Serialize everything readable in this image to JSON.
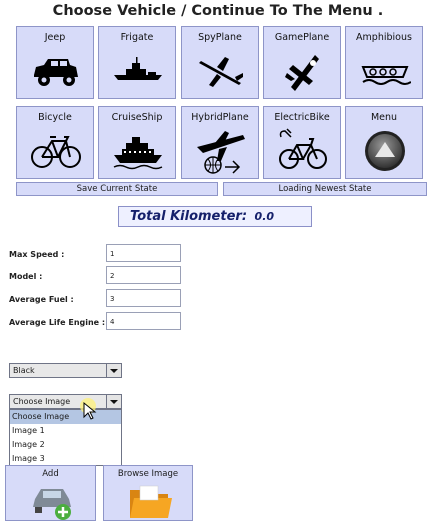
{
  "header": {
    "title": "Choose Vehicle / Continue To The Menu ."
  },
  "vehicles": [
    {
      "label": "Jeep",
      "icon": "jeep-icon"
    },
    {
      "label": "Frigate",
      "icon": "frigate-icon"
    },
    {
      "label": "SpyPlane",
      "icon": "spy-plane-icon"
    },
    {
      "label": "GamePlane",
      "icon": "game-plane-icon"
    },
    {
      "label": "Amphibious",
      "icon": "amphibious-icon"
    },
    {
      "label": "Bicycle",
      "icon": "bicycle-icon"
    },
    {
      "label": "CruiseShip",
      "icon": "cruise-ship-icon"
    },
    {
      "label": "HybridPlane",
      "icon": "hybrid-plane-icon"
    },
    {
      "label": "ElectricBike",
      "icon": "electric-bike-icon"
    },
    {
      "label": "Menu",
      "icon": "menu-up-icon"
    }
  ],
  "state": {
    "save_label": "Save Current State",
    "load_label": "Loading Newest State"
  },
  "total_km": {
    "label": "Total Kilometer:",
    "value": "0.0"
  },
  "form": {
    "fields": [
      {
        "label": "Max Speed :",
        "value": "1"
      },
      {
        "label": "Model :",
        "value": "2"
      },
      {
        "label": "Average Fuel :",
        "value": "3"
      },
      {
        "label": "Average Life Engine :",
        "value": "4"
      }
    ]
  },
  "color_combo": {
    "selected": "Black"
  },
  "image_combo": {
    "selected": "Choose Image",
    "options": [
      "Choose Image",
      "Image 1",
      "Image 2",
      "Image 3"
    ]
  },
  "bottom_buttons": {
    "add_label": "Add",
    "browse_label": "Browse Image"
  },
  "colors": {
    "button_bg": "#d7dbf9",
    "button_border": "#8e95c8",
    "km_text": "#15206b"
  }
}
